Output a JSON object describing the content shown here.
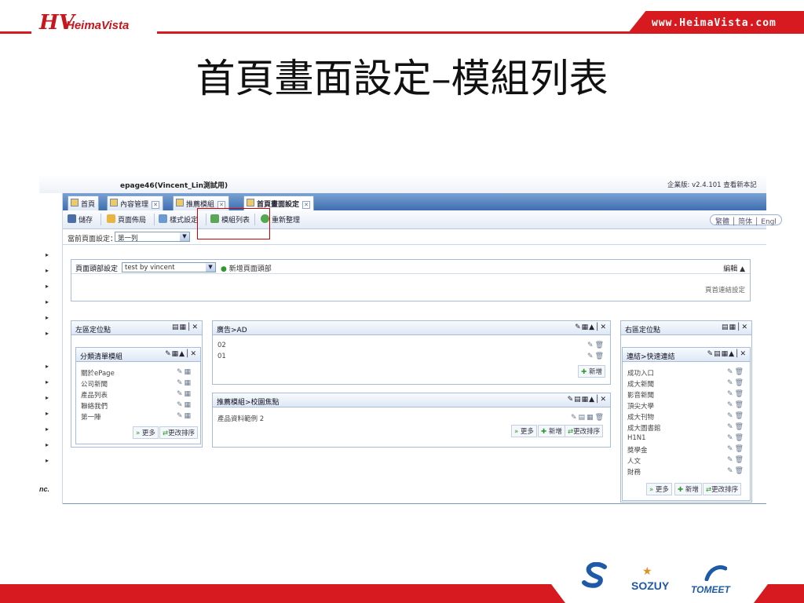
{
  "slide": {
    "brand": "HeimaVista",
    "logo_mark": "HV",
    "url": "www.HeimaVista.com",
    "title": "首頁畫面設定–模組列表"
  },
  "app": {
    "site_name": "epage46(Vincent_Lin測試用)",
    "version_info": "企業版: v2.4.101  查看新本記",
    "tabs": [
      {
        "label": "首頁"
      },
      {
        "label": "內容管理"
      },
      {
        "label": "推薦模組"
      },
      {
        "label": "首頁畫面設定"
      }
    ],
    "toolbar": {
      "save": "儲存",
      "layout": "頁面佈局",
      "style": "樣式設定",
      "modules": "模組列表",
      "reorder": "重新整理",
      "lang": "繁體 │ 简体 │ Engl"
    },
    "filter": {
      "label": "當前頁面設定：",
      "value": "第一列"
    },
    "header_panel": {
      "label": "頁面頭部設定",
      "select_value": "test by vincent",
      "add_link": "新增頁面頭部",
      "edit": "編輯 ▲",
      "link_setting": "頁首連結設定"
    },
    "left_panel": {
      "title": "左區定位點"
    },
    "category_panel": {
      "title": "分類清單模組",
      "items": [
        "關於ePage",
        "公司新聞",
        "產品列表",
        "聯絡我們",
        "第一陣"
      ],
      "more": "更多",
      "sort": "更改排序"
    },
    "ad_panel": {
      "title": "廣告>AD",
      "items": [
        "02",
        "01"
      ],
      "add": "新增"
    },
    "rec_panel": {
      "title": "推薦模組>校園焦點",
      "items": [
        "產品資料範例 2"
      ],
      "more": "更多",
      "add": "新增",
      "sort": "更改排序"
    },
    "right_panel": {
      "title": "右區定位點"
    },
    "links_panel": {
      "title": "連結>快速連結",
      "items": [
        "成功入口",
        "成大新聞",
        "影音新聞",
        "頂尖大學",
        "成大刊物",
        "成大圖書館",
        "H1N1",
        "獎學金",
        "人文",
        "財務"
      ],
      "more": "更多",
      "add": "新增",
      "sort": "更改排序"
    },
    "rail_text": "nc."
  },
  "footer": {
    "logos": [
      "SOZUY",
      "TOMEET"
    ]
  },
  "colors": {
    "brand_red": "#d71920",
    "tab_blue": "#3e6eb0",
    "highlight": "#d10000"
  }
}
